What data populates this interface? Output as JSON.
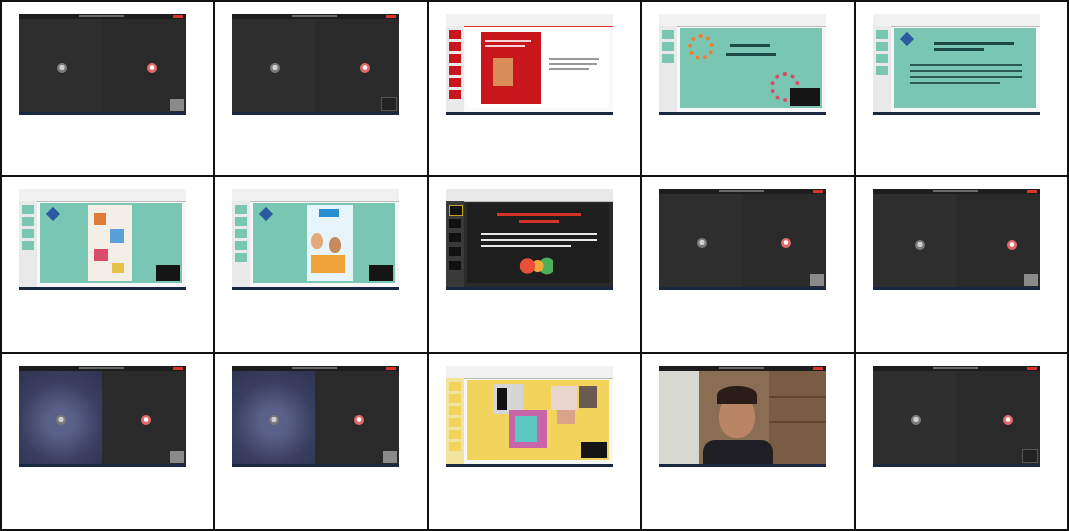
{
  "grid": {
    "rows": 3,
    "cols": 5,
    "cells": [
      {
        "id": "r1c1",
        "kind": "meeting-two-tiles"
      },
      {
        "id": "r1c2",
        "kind": "meeting-two-tiles"
      },
      {
        "id": "r1c3",
        "kind": "slide-red-book"
      },
      {
        "id": "r1c4",
        "kind": "slide-teal-que-es-un-ods"
      },
      {
        "id": "r1c5",
        "kind": "slide-teal-text"
      },
      {
        "id": "r2c1",
        "kind": "slide-teal-infographic"
      },
      {
        "id": "r2c2",
        "kind": "slide-teal-people"
      },
      {
        "id": "r2c3",
        "kind": "slide-dark-red-text"
      },
      {
        "id": "r2c4",
        "kind": "meeting-two-tiles"
      },
      {
        "id": "r2c5",
        "kind": "meeting-two-tiles"
      },
      {
        "id": "r3c1",
        "kind": "meeting-blue-tile"
      },
      {
        "id": "r3c2",
        "kind": "meeting-blue-tile"
      },
      {
        "id": "r3c3",
        "kind": "slide-yellow-collage"
      },
      {
        "id": "r3c4",
        "kind": "webcam-person"
      },
      {
        "id": "r3c5",
        "kind": "meeting-two-tiles"
      }
    ]
  },
  "colors": {
    "border": "#111111",
    "meeting_bg": "#2b2b2b",
    "teal": "#79c7b3",
    "red": "#c8161c",
    "yellow": "#f2d45c"
  }
}
